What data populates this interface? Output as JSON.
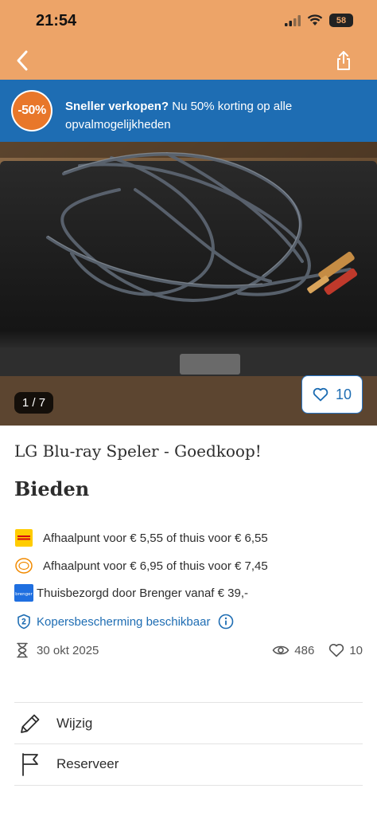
{
  "status": {
    "time": "21:54",
    "battery": "58"
  },
  "promo": {
    "badge": "-50%",
    "headline": "Sneller verkopen?",
    "body": "Nu 50% korting op alle opvalmogelijkheden"
  },
  "photo": {
    "counter": "1 / 7",
    "favorites": "10"
  },
  "listing": {
    "title": "LG Blu-ray Speler - Goedkoop!",
    "price": "Bieden"
  },
  "shipping": [
    {
      "carrier_icon": "dhl-icon",
      "text": "Afhaalpunt voor  € 5,55  of thuis voor  € 6,55"
    },
    {
      "carrier_icon": "postnl-icon",
      "text": "Afhaalpunt voor  € 6,95  of thuis voor  € 7,45"
    },
    {
      "carrier_icon": "brenger-icon",
      "carrier_label": "brenger",
      "text": "Thuisbezorgd door Brenger vanaf € 39,-"
    }
  ],
  "buyer_protection": "Kopersbescherming beschikbaar",
  "meta": {
    "date": "30 okt 2025",
    "views": "486",
    "favorites": "10"
  },
  "actions": {
    "edit": "Wijzig",
    "reserve": "Reserveer"
  },
  "colors": {
    "header": "#eda468",
    "promo": "#1e6db3",
    "accent": "#1e6db3",
    "badge": "#e8772a"
  }
}
